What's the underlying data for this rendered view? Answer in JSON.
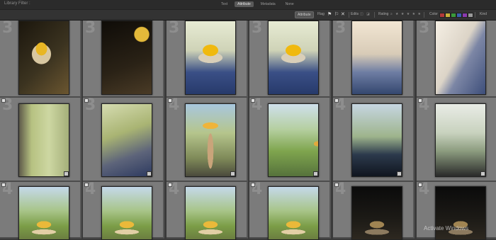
{
  "filter_bar": {
    "title": "Library Filter :",
    "tabs": [
      {
        "label": "Text",
        "active": false
      },
      {
        "label": "Attribute",
        "active": true
      },
      {
        "label": "Metadata",
        "active": false
      },
      {
        "label": "None",
        "active": false
      }
    ],
    "attribute_label": "Attribute",
    "flag_label": "Flag",
    "edits_label": "Edits",
    "rating_label": "Rating",
    "rating_stars": "★ ★ ★ ★ ★",
    "color_label": "Color",
    "color_swatches": [
      "#b33a3a",
      "#c9b23a",
      "#3a9a3a",
      "#3a5fb0",
      "#8a3ab0",
      "#9a9a9a"
    ],
    "kind_label": "Kind"
  },
  "grid": {
    "rows": [
      {
        "cells": [
          {
            "number": "3",
            "thumb": "t-dark-fruit"
          },
          {
            "number": "3",
            "thumb": "t-dark-wood"
          },
          {
            "number": "3",
            "thumb": "t-bowl-sky"
          },
          {
            "number": "3",
            "thumb": "t-bowl-sky"
          },
          {
            "number": "3",
            "thumb": "t-window-light"
          },
          {
            "number": "3",
            "thumb": "t-window-frame"
          }
        ]
      },
      {
        "cells": [
          {
            "number": "3",
            "thumb": "t-post-green"
          },
          {
            "number": "3",
            "thumb": "t-frame-green"
          },
          {
            "number": "4",
            "thumb": "t-pedestal"
          },
          {
            "number": "4",
            "thumb": "t-green-sky"
          },
          {
            "number": "4",
            "thumb": "t-dark-sill"
          },
          {
            "number": "4",
            "thumb": "t-white-frame"
          }
        ]
      },
      {
        "cells": [
          {
            "number": "4",
            "thumb": "t-bowl-green"
          },
          {
            "number": "4",
            "thumb": "t-bowl-green"
          },
          {
            "number": "4",
            "thumb": "t-bowl-green"
          },
          {
            "number": "4",
            "thumb": "t-bowl-green"
          },
          {
            "number": "4",
            "thumb": "t-bowl-dark"
          },
          {
            "number": "4",
            "thumb": "t-bowl-dark"
          }
        ]
      }
    ]
  },
  "watermark": "Activate Windows"
}
